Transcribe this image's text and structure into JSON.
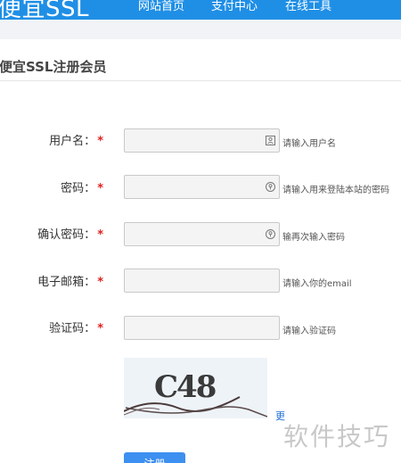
{
  "header": {
    "brand": "便宜SSL",
    "nav": [
      "网站首页",
      "支付中心",
      "在线工具"
    ]
  },
  "section": {
    "title": "便宜SSL注册会员"
  },
  "form": {
    "required_mark": "*",
    "rows": [
      {
        "label": "用户名：",
        "value": "",
        "hint": "请输入用户名",
        "icon": "contact-card-icon"
      },
      {
        "label": "密码：",
        "value": "",
        "hint": "请输入用来登陆本站的密码",
        "icon": "key-icon"
      },
      {
        "label": "确认密码：",
        "value": "",
        "hint": "输再次输入密码",
        "icon": "key-icon"
      },
      {
        "label": "电子邮箱：",
        "value": "",
        "hint": "请输入你的email",
        "icon": ""
      },
      {
        "label": "验证码：",
        "value": "",
        "hint": "请输入验证码",
        "icon": ""
      }
    ],
    "captcha_text": "C48",
    "captcha_refresh": "更",
    "submit_label": "注册"
  },
  "watermark": "软件技巧",
  "colors": {
    "header_bg": "#1f8fe6",
    "button_bg": "#3d8ff0",
    "required": "#e02020"
  }
}
